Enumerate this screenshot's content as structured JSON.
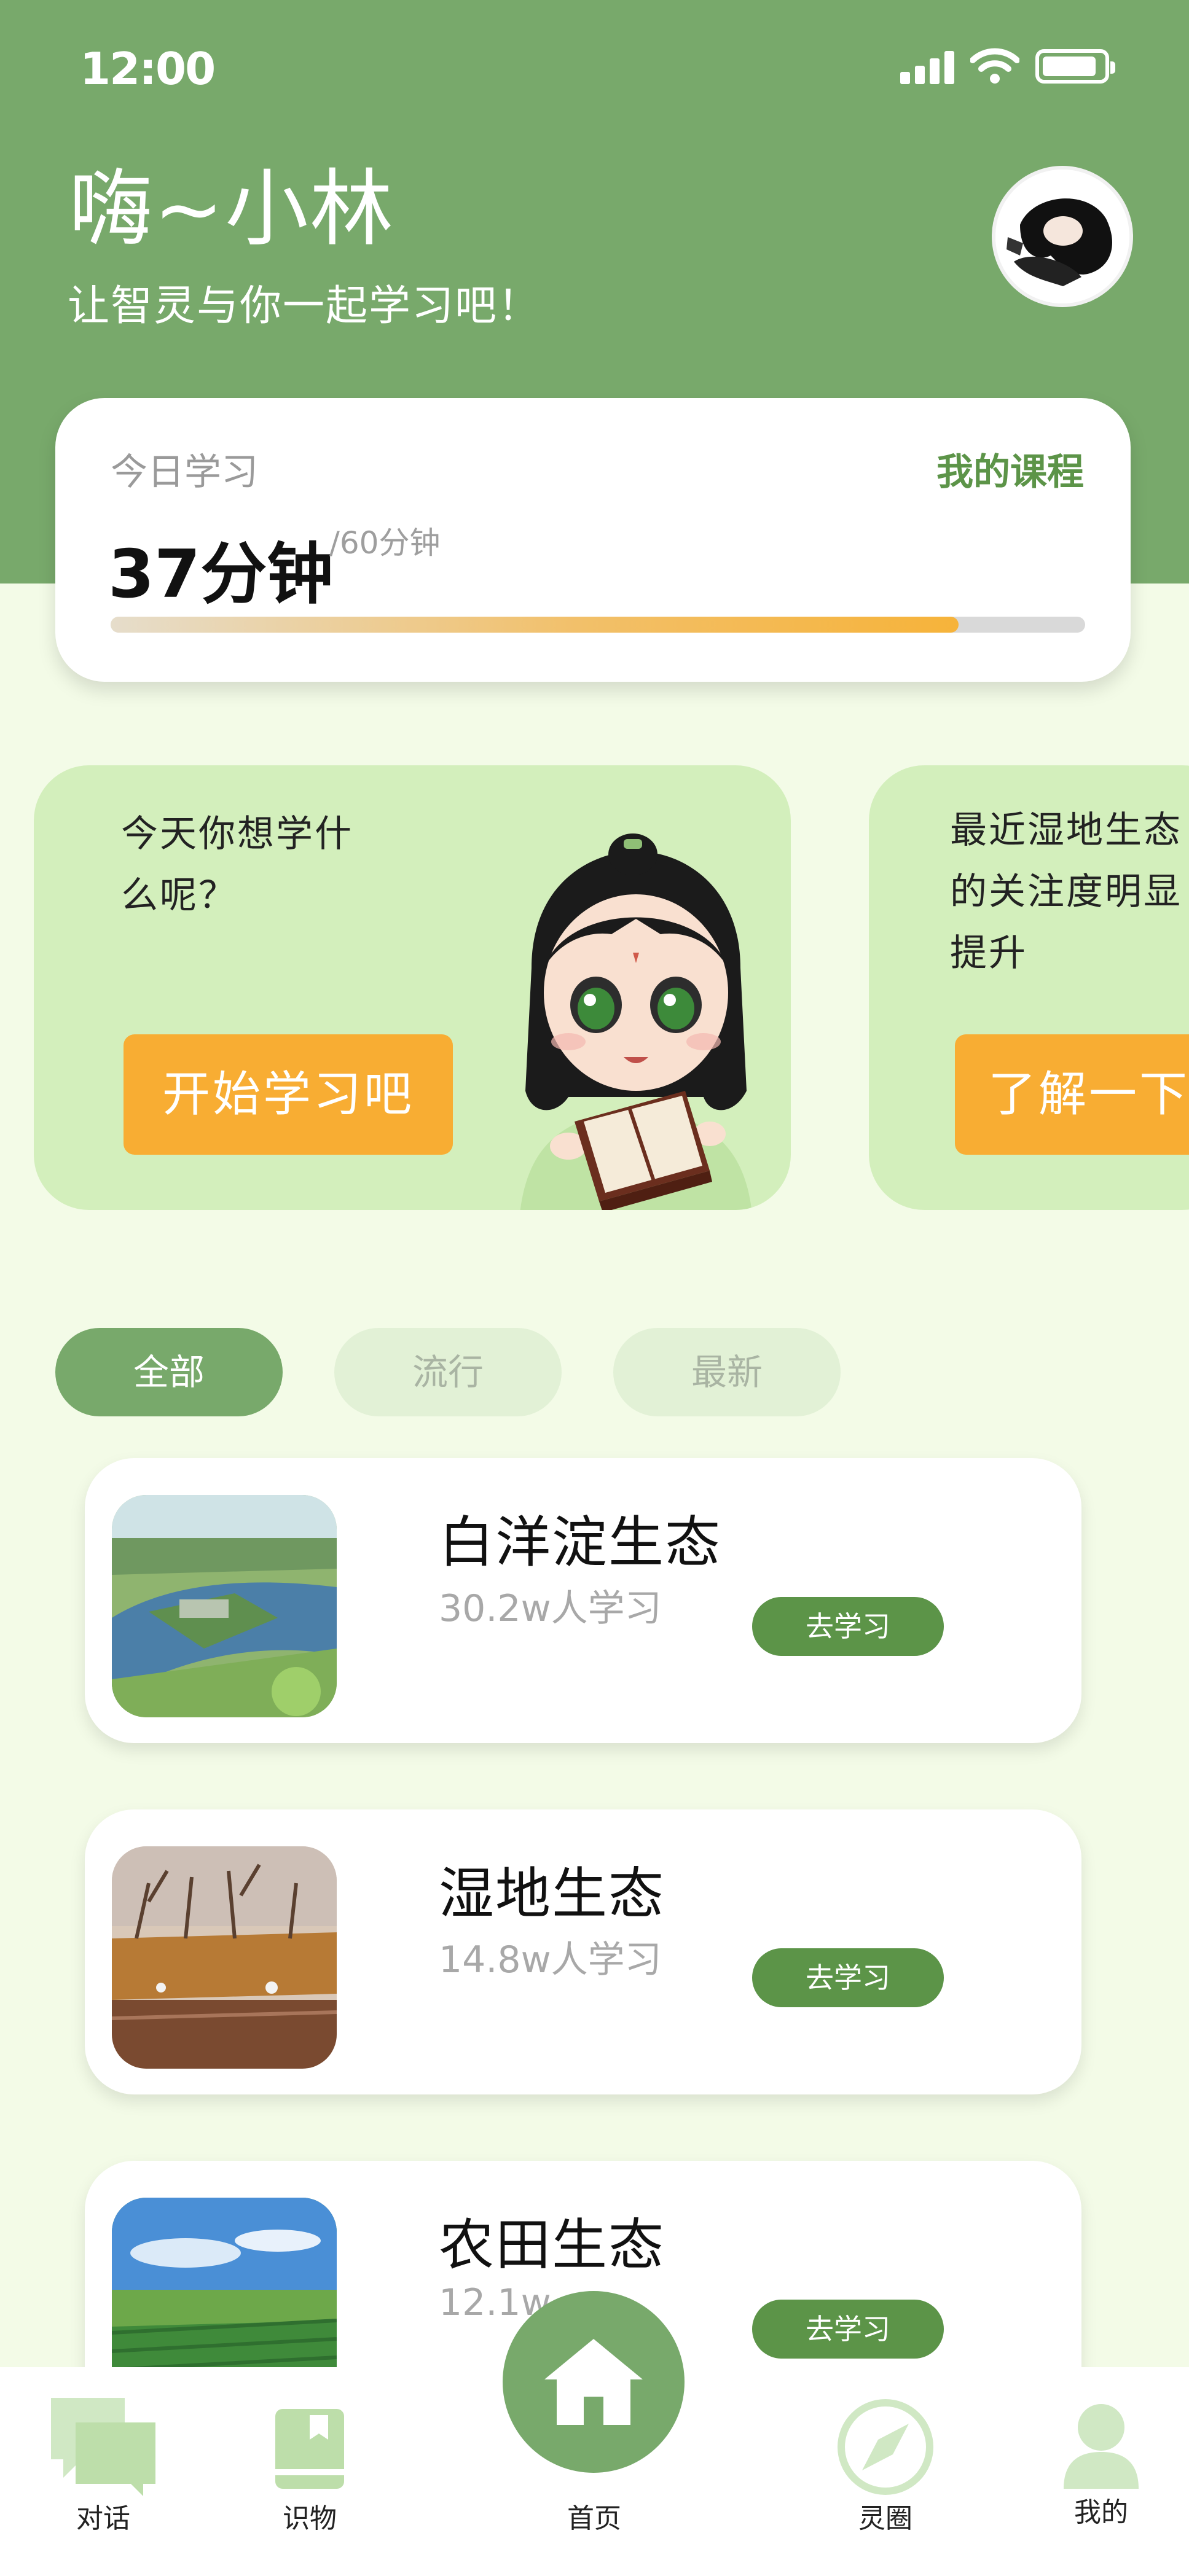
{
  "status_bar": {
    "time": "12:00",
    "signal_icon": "signal-icon",
    "wifi_icon": "wifi-icon",
    "battery_icon": "battery-icon"
  },
  "header": {
    "greeting": "嗨~小林",
    "subtitle": "让智灵与你一起学习吧！",
    "avatar_icon": "avatar"
  },
  "study_card": {
    "label": "今日学习",
    "my_courses": "我的课程",
    "minutes": "37分钟",
    "goal": "/60分钟",
    "progress_fraction": 0.87
  },
  "banners": [
    {
      "text": "今天你想学什么呢？",
      "button": "开始学习吧"
    },
    {
      "text": "最近湿地生态的关注度明显提升",
      "button": "了解一下"
    }
  ],
  "filters": [
    {
      "label": "全部",
      "active": true
    },
    {
      "label": "流行",
      "active": false
    },
    {
      "label": "最新",
      "active": false
    }
  ],
  "courses": [
    {
      "title": "白洋淀生态",
      "count": "30.2w人学习",
      "button": "去学习"
    },
    {
      "title": "湿地生态",
      "count": "14.8w人学习",
      "button": "去学习"
    },
    {
      "title": "农田生态",
      "count": "12.1w",
      "button": "去学习"
    }
  ],
  "nav": {
    "items": [
      {
        "label": "对话",
        "icon": "chat-icon"
      },
      {
        "label": "识物",
        "icon": "book-icon"
      },
      {
        "label": "首页",
        "icon": "home-icon"
      },
      {
        "label": "灵圈",
        "icon": "compass-icon"
      },
      {
        "label": "我的",
        "icon": "user-icon"
      }
    ]
  },
  "colors": {
    "primary": "#78A96B",
    "button_dark": "#5C9448",
    "accent": "#F8AD33",
    "banner": "#D3EFBC",
    "page_bg": "#F3FBE7"
  }
}
